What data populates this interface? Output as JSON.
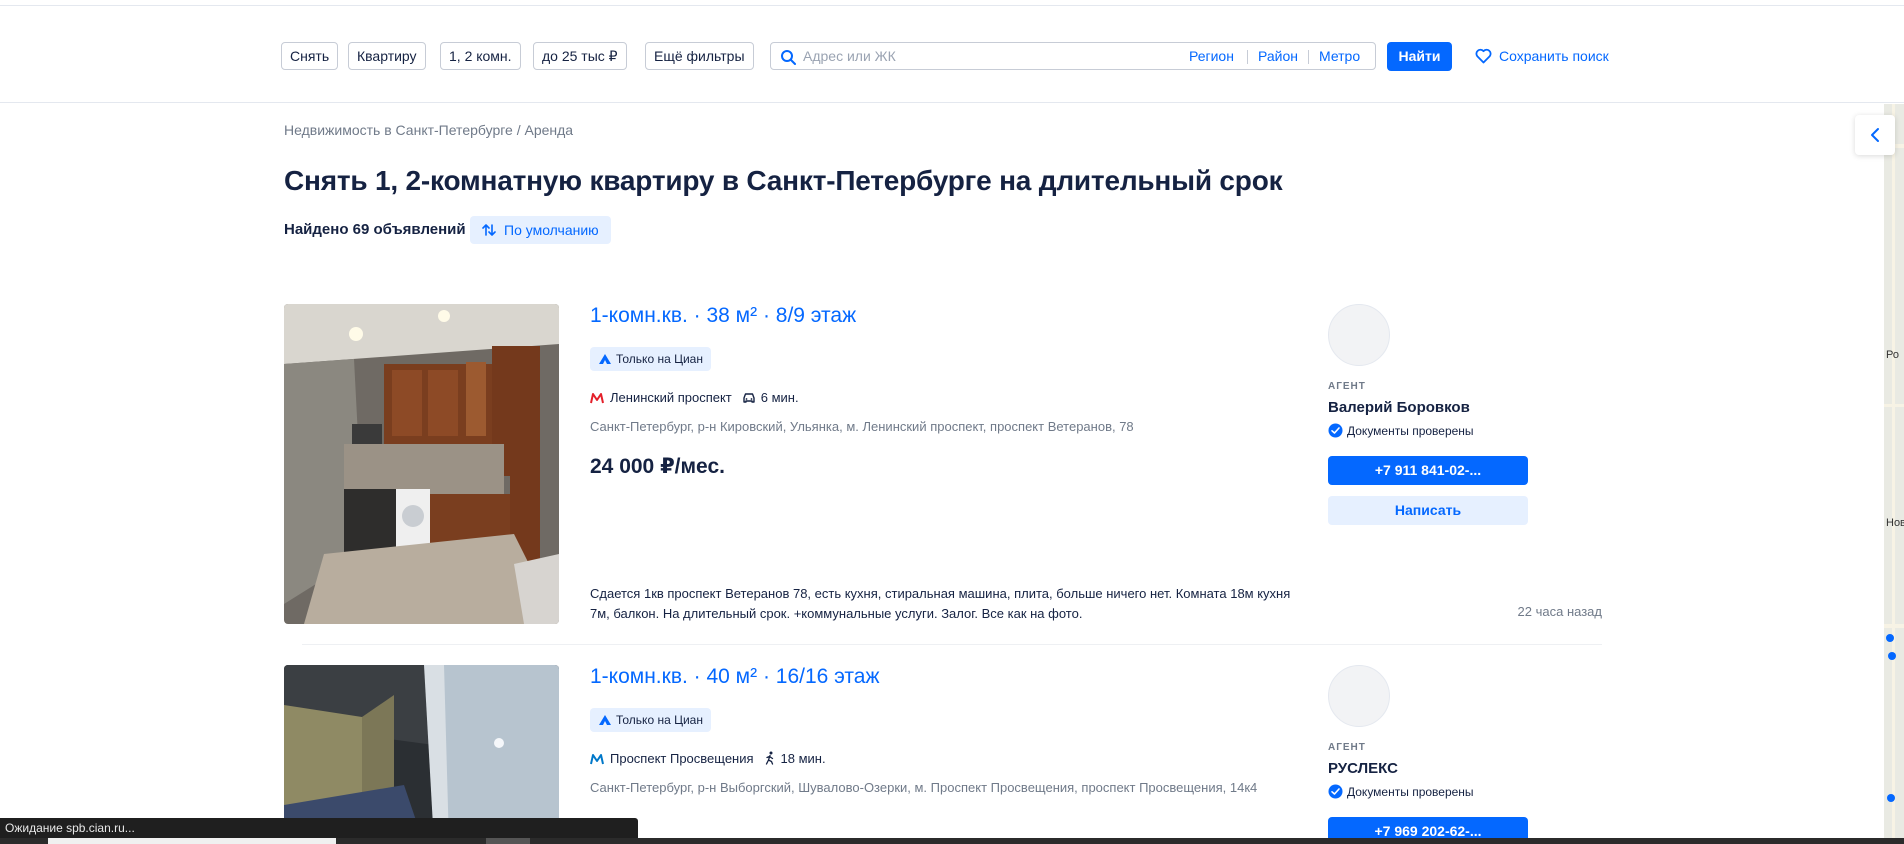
{
  "filters": {
    "deal": "Снять",
    "object_type": "Квартиру",
    "rooms": "1, 2 комн.",
    "price": "до 25 тыс ₽",
    "more": "Ещё фильтры"
  },
  "search": {
    "placeholder": "Адрес или ЖК",
    "region": "Регион",
    "district": "Район",
    "metro": "Метро",
    "find": "Найти",
    "save": "Сохранить поиск"
  },
  "breadcrumb": "Недвижимость в Санкт-Петербурге / Аренда",
  "title": "Снять 1, 2-комнатную квартиру в Санкт-Петербурге на длительный срок",
  "found": "Найдено 69 объявлений",
  "sort": "По умолчанию",
  "map_labels": [
    "Ро",
    "Нов"
  ],
  "listings": [
    {
      "title": "1-комн.кв. · 38 м² · 8/9 этаж",
      "badge": "Только на Циан",
      "metro_color": "#e4202a",
      "metro": "Ленинский проспект",
      "travel": "6 мин.",
      "travel_mode": "car-icon",
      "address": "Санкт-Петербург, р-н Кировский, Ульянка, м. Ленинский проспект, проспект Ветеранов, 78",
      "price": "24 000 ₽/мес.",
      "description": "Сдается 1кв проспект Ветеранов 78, есть кухня, стиральная машина, плита, больше ничего нет. Комната 18м кухня 7м, балкон. На длительный срок. +коммунальные услуги. Залог. Все как на фото.",
      "time": "22 часа назад",
      "agent_type": "АГЕНТ",
      "agent_name": "Валерий Боровков",
      "verified": "Документы проверены",
      "phone": "+7 911 841-02-...",
      "write": "Написать"
    },
    {
      "title": "1-комн.кв. · 40 м² · 16/16 этаж",
      "badge": "Только на Циан",
      "metro_color": "#0078c9",
      "metro": "Проспект Просвещения",
      "travel": "18 мин.",
      "travel_mode": "walk-icon",
      "address": "Санкт-Петербург, р-н Выборгский, Шувалово-Озерки, м. Проспект Просвещения, проспект Просвещения, 14к4",
      "agent_type": "АГЕНТ",
      "agent_name": "РУСЛЕКС",
      "verified": "Документы проверены",
      "phone": "+7 969 202-62-..."
    }
  ],
  "status_bar": "Ожидание spb.cian.ru...",
  "colors": {
    "accent": "#0468ff",
    "accent_light": "#e6f0ff",
    "text": "#152242",
    "muted": "#707a89"
  }
}
